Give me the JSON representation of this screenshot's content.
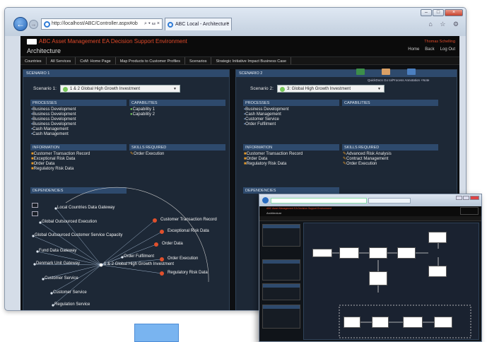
{
  "browser": {
    "address": "http://localhost/ABC/Controller.aspx#ob",
    "address_controls": "⌕ ▾ ☳ ×",
    "tab_title": "ABC Local - Architecture",
    "tab_close": "×",
    "window_buttons": [
      "–",
      "□",
      "×"
    ],
    "back_glyph": "←",
    "forward_glyph": "→",
    "tools_glyphs": "⌂ ☆ ⚙"
  },
  "app": {
    "name": "ABC Asset Management   EA Decision Support Environment",
    "title": "Architecture",
    "user": "Thomas Schelling",
    "header_links": [
      "Home",
      "Back",
      "Log Out"
    ],
    "menu": [
      "Countries",
      "All Services",
      "CxM: Home Page",
      "Map Products to Customer Profiles",
      "Scenarios",
      "Strategic Initiative Impact Business Case"
    ]
  },
  "scenario1": {
    "header": "SCENARIO 1",
    "label": "Scenario 1:",
    "selected": "1 & 2 Global High Growth Investment",
    "processes_header": "PROCESSES",
    "processes": [
      "Business Development",
      "Business Development",
      "Business Development",
      "Business Development",
      "Cash Management",
      "Cash Management"
    ],
    "capabilities_header": "CAPABILITIES",
    "capabilities": [
      "Capability 1",
      "Capability 2"
    ],
    "information_header": "INFORMATION",
    "information": [
      "Customer Transaction Record",
      "Exceptional Risk Data",
      "Order Data",
      "Regulatory Risk Data"
    ],
    "skills_header": "SKILLS REQUIRED",
    "skills": [
      "Order Execution"
    ],
    "dependencies_header": "DEPENDENCIES",
    "graph_center": "1 & 2 Global High Growth Investment",
    "graph_nodes": [
      "Local Countries Data Gateway",
      "Global Outsourced Execution",
      "Global Outsourced Customer Service Capacity",
      "Fund Data Gateway",
      "Denmark Unit Gateway",
      "Customer Service",
      "Customer Service",
      "Regulation Service",
      "Order Fulfilment",
      "Customer Transaction Record",
      "Exceptional Risk Data",
      "Order Data",
      "Order Execution",
      "Regulatory Risk Data"
    ]
  },
  "scenario2": {
    "header": "SCENARIO 2",
    "label": "Scenario 2:",
    "selected": "3: Global High Growth Investment",
    "icon_labels": "QuickDocs   Go to/Process   Annotation   +Note",
    "processes_header": "PROCESSES",
    "processes": [
      "Business Development",
      "Cash Management",
      "Customer Service",
      "Order Fulfilment"
    ],
    "capabilities_header": "CAPABILITIES",
    "information_header": "INFORMATION",
    "information": [
      "Customer Transaction Record",
      "Order Data",
      "Regulatory Risk Data"
    ],
    "skills_header": "SKILLS REQUIRED",
    "skills": [
      "Advanced Risk Analysis",
      "Contract Management",
      "Order Execution"
    ],
    "dependencies_header": "DEPENDENCIES"
  },
  "colors": {
    "page_bg": "#0d0f12",
    "panel_bg": "#1d2836",
    "section_bar": "#2e4a6d",
    "accent": "#e04a2a",
    "process_icon": "#7ea7d9",
    "info_icon": "#e59a2a",
    "capability_icon": "#74c65a"
  },
  "icons": [
    "back-icon",
    "forward-icon",
    "ie-icon",
    "home-icon",
    "star-icon",
    "gear-icon",
    "dropdown-arrow-icon",
    "zoom-icon",
    "magnifier-icon"
  ]
}
